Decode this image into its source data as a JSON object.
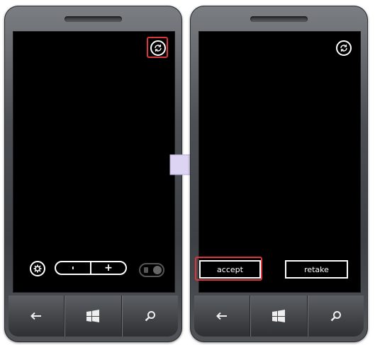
{
  "left_phone": {
    "top_icon": "switch-camera-icon",
    "settings_icon": "settings-gear-icon",
    "zoom": {
      "minus": "-",
      "plus": "+"
    },
    "flash_icon": "flash-toggle-icon"
  },
  "right_phone": {
    "top_icon": "switch-camera-icon",
    "accept_label": "accept",
    "retake_label": "retake"
  },
  "nav": {
    "back_icon": "back-arrow-icon",
    "start_icon": "windows-start-icon",
    "search_icon": "search-icon"
  },
  "colors": {
    "highlight": "#d9363e",
    "arrow_fill": "#dcd4f2"
  }
}
